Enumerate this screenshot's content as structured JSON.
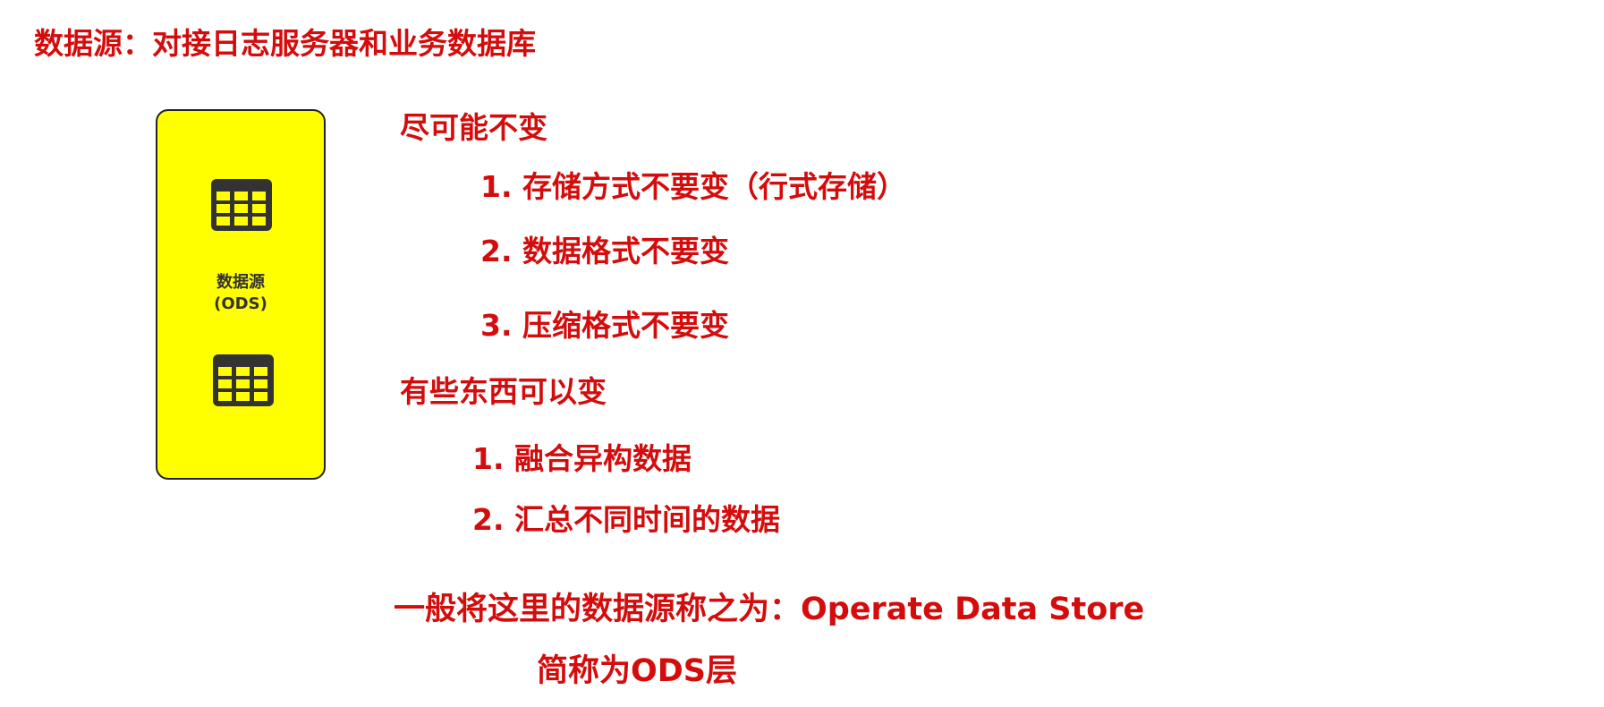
{
  "title": "数据源：对接日志服务器和业务数据库",
  "ods_box": {
    "label_line1": "数据源",
    "label_line2": "(ODS)",
    "color": "#ffff00",
    "icons": [
      "table-icon",
      "table-icon"
    ]
  },
  "unchanged": {
    "heading": "尽可能不变",
    "items": [
      "1. 存储方式不要变（行式存储）",
      "2. 数据格式不要变",
      "3. 压缩格式不要变"
    ]
  },
  "changeable": {
    "heading": "有些东西可以变",
    "items": [
      "1. 融合异构数据",
      "2. 汇总不同时间的数据"
    ]
  },
  "summary": {
    "line1": "一般将这里的数据源称之为：Operate Data Store",
    "line2": "简称为ODS层"
  },
  "colors": {
    "text": "#d40c0c",
    "box": "#ffff00",
    "icon": "#333333"
  }
}
